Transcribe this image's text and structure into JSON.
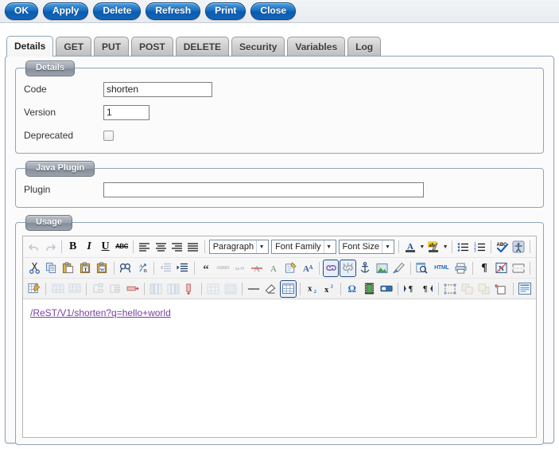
{
  "toolbar_top": {
    "buttons": [
      {
        "label": "OK",
        "name": "ok-button"
      },
      {
        "label": "Apply",
        "name": "apply-button"
      },
      {
        "label": "Delete",
        "name": "delete-button"
      },
      {
        "label": "Refresh",
        "name": "refresh-button"
      },
      {
        "label": "Print",
        "name": "print-button"
      },
      {
        "label": "Close",
        "name": "close-button"
      }
    ]
  },
  "tabs": [
    {
      "label": "Details",
      "active": true
    },
    {
      "label": "GET",
      "active": false
    },
    {
      "label": "PUT",
      "active": false
    },
    {
      "label": "POST",
      "active": false
    },
    {
      "label": "DELETE",
      "active": false
    },
    {
      "label": "Security",
      "active": false
    },
    {
      "label": "Variables",
      "active": false
    },
    {
      "label": "Log",
      "active": false
    }
  ],
  "details": {
    "legend": "Details",
    "code_label": "Code",
    "code_value": "shorten",
    "version_label": "Version",
    "version_value": "1",
    "deprecated_label": "Deprecated",
    "deprecated_checked": false
  },
  "java_plugin": {
    "legend": "Java Plugin",
    "plugin_label": "Plugin",
    "plugin_value": "",
    "plugin_placeholder": ""
  },
  "usage": {
    "legend": "Usage",
    "content_link": "/ReST/V1/shorten?q=hello+world",
    "link_color": "#7a3fa0"
  },
  "editor_toolbar": {
    "row1": {
      "undo": "undo-icon",
      "redo": "redo-icon",
      "bold": "B",
      "italic": "I",
      "underline": "U",
      "strikethrough": "ABC",
      "align_left": "align-left-icon",
      "align_center": "align-center-icon",
      "align_right": "align-right-icon",
      "align_justify": "align-justify-icon",
      "paragraph_select": "Paragraph",
      "font_family_select": "Font Family",
      "font_size_select": "Font Size",
      "text_color": "A",
      "highlight_color": "ab",
      "unordered_list": "bullet-list-icon",
      "ordered_list": "numbered-list-icon",
      "spellcheck": "spellcheck-icon",
      "accessibility": "accessibility-icon"
    },
    "row2": {
      "cut": "cut-icon",
      "copy": "copy-icon",
      "paste": "paste-icon",
      "paste_text": "paste-as-text-icon",
      "paste_word": "paste-from-word-icon",
      "find": "find-icon",
      "replace": "find-replace-icon",
      "outdent": "outdent-icon",
      "indent": "indent-icon",
      "blockquote": "blockquote-icon",
      "abbreviation": "ABBR",
      "quotation": "quotation-icon",
      "delete_formatting": "remove-format-icon",
      "insert_letter": "insert-character-icon",
      "insert_note": "insert-note-icon",
      "style_props": "style-properties-icon",
      "insert_link": "insert-link-icon",
      "unlink": "unlink-icon",
      "anchor": "anchor-icon",
      "insert_image": "insert-image-icon",
      "cleanup": "cleanup-icon",
      "preview": "preview-icon",
      "html_source": "HTML",
      "print": "print-icon",
      "show_paragraphs": "pilcrow-icon",
      "nonbreaking": "nonbreaking-icon",
      "page_break": "page-break-icon"
    },
    "row3": {
      "table_props": "table-properties-icon",
      "insert_row_before": "insert-row-before-icon",
      "insert_row_after": "insert-row-after-icon",
      "row_props": "row-properties-icon",
      "cell_props": "cell-properties-icon",
      "delete_row": "delete-row-icon",
      "insert_col_before": "insert-column-before-icon",
      "insert_col_after": "insert-column-after-icon",
      "delete_col": "delete-column-icon",
      "split_cells": "split-cells-icon",
      "merge_cells": "merge-cells-icon",
      "horizontal_rule": "horizontal-rule-icon",
      "eraser": "eraser-icon",
      "grid": "grid-icon",
      "subscript": "subscript-icon",
      "superscript": "superscript-icon",
      "special_char": "omega-icon",
      "insert_media": "insert-media-icon",
      "insert_embed": "insert-embed-icon",
      "ltr": "left-to-right-icon",
      "rtl": "right-to-left-icon",
      "fullscreen": "fullscreen-icon",
      "layer_back": "layer-back-icon",
      "layer_front": "layer-front-icon",
      "add_layer": "add-layer-icon",
      "template": "template-icon"
    }
  }
}
